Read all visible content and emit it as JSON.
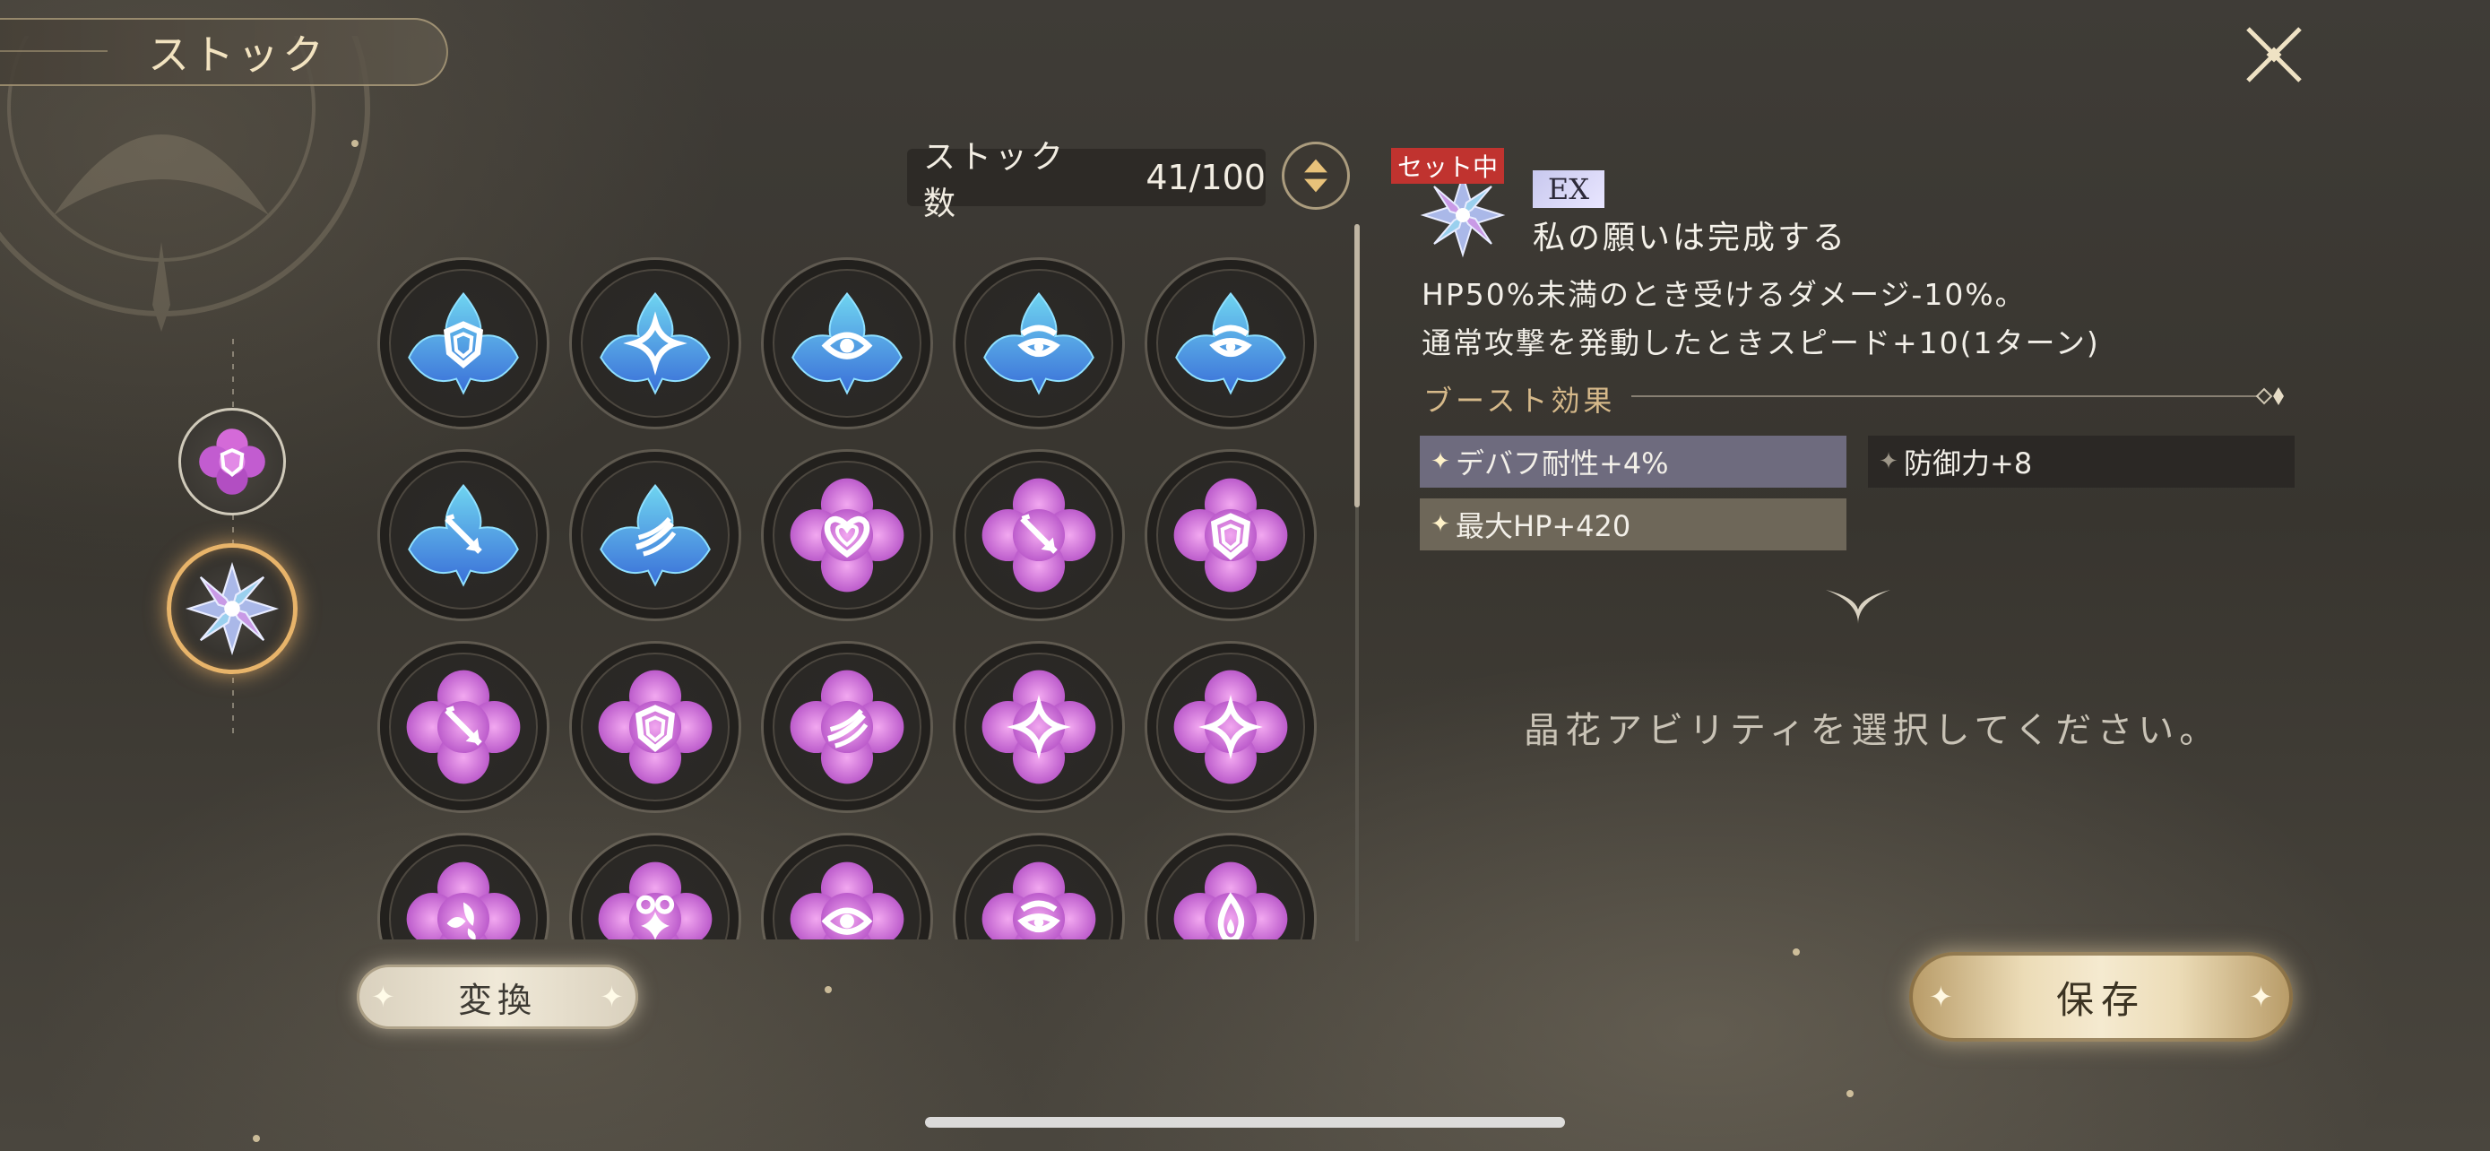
{
  "header": {
    "title": "ストック"
  },
  "stock": {
    "label": "ストック数",
    "value": "41/100"
  },
  "grid": {
    "rows": [
      [
        {
          "color": "blue",
          "icon": "shield-icon"
        },
        {
          "color": "blue",
          "icon": "star-icon"
        },
        {
          "color": "blue",
          "icon": "eye-icon"
        },
        {
          "color": "blue",
          "icon": "guard-icon"
        },
        {
          "color": "blue",
          "icon": "guard-icon"
        }
      ],
      [
        {
          "color": "blue",
          "icon": "arrow-icon"
        },
        {
          "color": "blue",
          "icon": "wing-icon"
        },
        {
          "color": "pink",
          "icon": "heart-icon"
        },
        {
          "color": "pink",
          "icon": "arrow-icon"
        },
        {
          "color": "pink",
          "icon": "shield-icon"
        }
      ],
      [
        {
          "color": "pink",
          "icon": "arrow-icon"
        },
        {
          "color": "pink",
          "icon": "shield-icon"
        },
        {
          "color": "pink",
          "icon": "wing-icon"
        },
        {
          "color": "pink",
          "icon": "star-icon"
        },
        {
          "color": "pink",
          "icon": "star-icon"
        }
      ],
      [
        {
          "color": "pink",
          "icon": "leaf-icon"
        },
        {
          "color": "pink",
          "icon": "sparkle-icon"
        },
        {
          "color": "pink",
          "icon": "eye-icon"
        },
        {
          "color": "pink",
          "icon": "guard-icon"
        },
        {
          "color": "pink",
          "icon": "flame-icon"
        }
      ]
    ]
  },
  "detail": {
    "set_badge": "セット中",
    "rank": "EX",
    "name": "私の願いは完成する",
    "effects": [
      "HP50%未満のとき受けるダメージ-10%。",
      "通常攻撃を発動したときスピード+10(1ターン)"
    ],
    "boost_title": "ブースト効果",
    "boosts": [
      "デバフ耐性+4%",
      "防御力+8",
      "最大HP+420"
    ],
    "hint": "晶花アビリティを選択してください。"
  },
  "buttons": {
    "convert": "変換",
    "save": "保存"
  },
  "colors": {
    "blue_gem": "#4a8fe0",
    "pink_gem": "#d46ad8",
    "gold": "#e8b46a",
    "badge_red": "#c0332f"
  }
}
